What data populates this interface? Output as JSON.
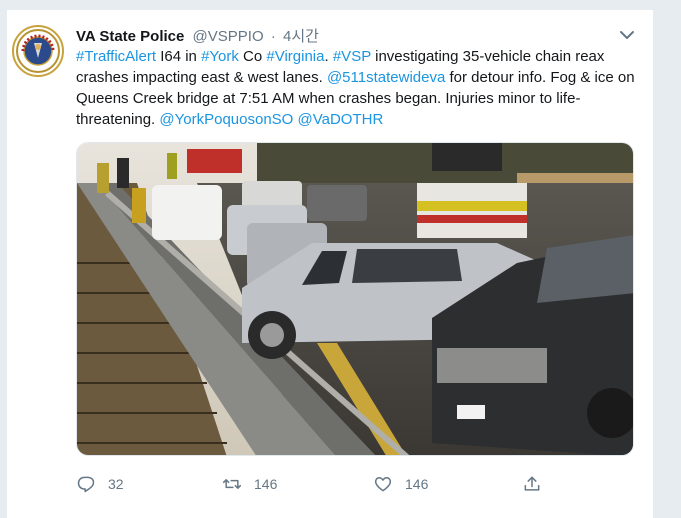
{
  "tweet": {
    "author_name": "VA State Police",
    "handle": "@VSPPIO",
    "separator": "·",
    "time": "4시간",
    "text_parts": [
      {
        "t": "#TrafficAlert",
        "link": true
      },
      {
        "t": " I64 in ",
        "link": false
      },
      {
        "t": "#York",
        "link": true
      },
      {
        "t": " Co ",
        "link": false
      },
      {
        "t": "#Virginia",
        "link": true
      },
      {
        "t": ". ",
        "link": false
      },
      {
        "t": "#VSP",
        "link": true
      },
      {
        "t": " investigating 35-vehicle chain reax crashes impacting east & west lanes. ",
        "link": false
      },
      {
        "t": "@511statewideva",
        "link": true
      },
      {
        "t": " for detour info. Fog & ice on Queens Creek bridge at 7:51 AM when crashes began. Injuries minor to life-threatening. ",
        "link": false
      },
      {
        "t": "@YorkPoquosonSO",
        "link": true
      },
      {
        "t": " ",
        "link": false
      },
      {
        "t": "@VaDOTHR",
        "link": true
      }
    ],
    "media_icon": "crash-scene-photo",
    "actions": {
      "reply_count": "32",
      "retweet_count": "146",
      "like_count": "146"
    }
  },
  "colors": {
    "link": "#1b95e0",
    "secondary": "#657786",
    "text": "#14171a"
  }
}
